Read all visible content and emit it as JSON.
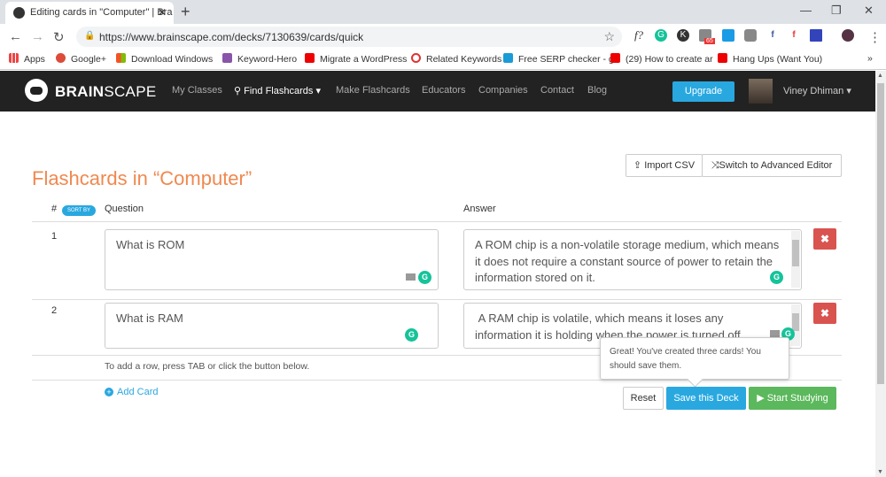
{
  "browser": {
    "tab_title": "Editing cards in \"Computer\" | Bra",
    "url": "https://www.brainscape.com/decks/7130639/cards/quick",
    "extension_badge": "65",
    "bookmarks": [
      "Apps",
      "Google+",
      "Download Windows",
      "Keyword-Hero",
      "Migrate a WordPress",
      "Related Keywords",
      "Free SERP checker - g",
      "(29) How to create ar",
      "Hang Ups (Want You)"
    ],
    "more": "»"
  },
  "nav": {
    "brand_bold": "BRAIN",
    "brand_rest": "SCAPE",
    "links": [
      "My Classes",
      "Find Flashcards",
      "Make Flashcards",
      "Educators",
      "Companies",
      "Contact",
      "Blog"
    ],
    "upgrade": "Upgrade",
    "user": "Viney Dhiman"
  },
  "page": {
    "title": "Flashcards in “Computer”",
    "import_csv": "Import CSV",
    "advanced_editor": "Switch to Advanced Editor",
    "col_num": "#",
    "sort_by": "SORT BY",
    "col_question": "Question",
    "col_answer": "Answer",
    "cards": [
      {
        "num": "1",
        "question": "What is ROM",
        "answer": "A ROM chip is a non-volatile storage medium, which means it does not require a constant source of power to retain the information stored on it."
      },
      {
        "num": "2",
        "question": "What is RAM",
        "answer": " A RAM chip is volatile, which means it loses any information it is holding when the power is turned off."
      }
    ],
    "hint": "To add a row, press TAB or click the button below.",
    "add_card": "Add Card",
    "tooltip": "Great! You've created three cards! You should save them.",
    "reset": "Reset",
    "save": "Save this Deck",
    "start": "Start Studying"
  },
  "colors": {
    "accent": "#29a8e0",
    "title": "#f0884f",
    "danger": "#d9534f",
    "success": "#5cb85c"
  }
}
